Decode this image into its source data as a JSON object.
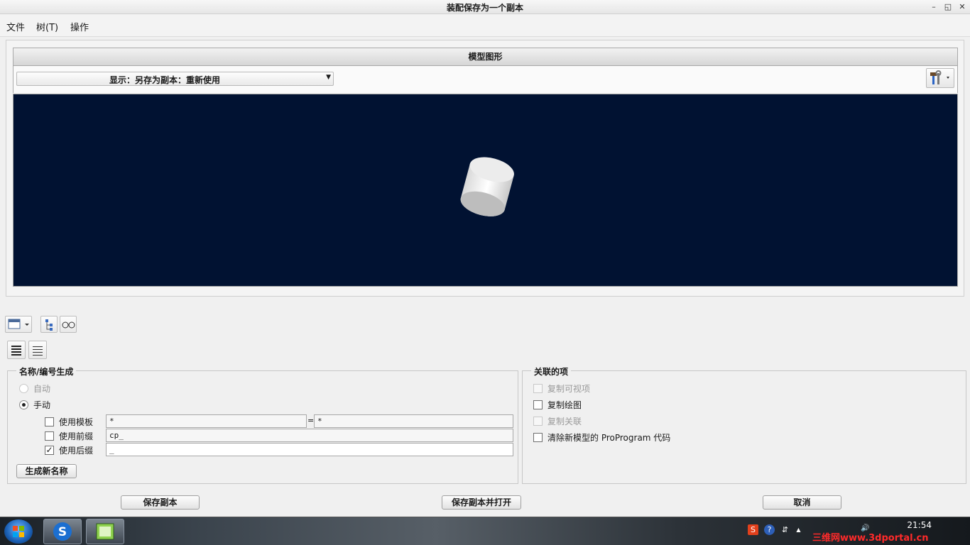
{
  "window": {
    "title": "装配保存为一个副本",
    "controls": {
      "minimize": "–",
      "restore": "◱",
      "close": "✕"
    }
  },
  "menubar": {
    "items": [
      "文件",
      "树(T)",
      "操作"
    ]
  },
  "model": {
    "header": "模型图形",
    "display_select": "显示：另存为副本：重新使用",
    "viewport_color": "#011232",
    "shape_icon": "cylinder-icon"
  },
  "name_gen": {
    "title": "名称/编号生成",
    "auto_label": "自动",
    "manual_label": "手动",
    "mode": "manual",
    "use_template": {
      "label": "使用模板",
      "checked": false,
      "value_left": "*",
      "equals": "=",
      "value_right": "*"
    },
    "use_prefix": {
      "label": "使用前缀",
      "checked": false,
      "value": "cp_"
    },
    "use_suffix": {
      "label": "使用后缀",
      "checked": true,
      "value": "_"
    },
    "generate_button": "生成新名称"
  },
  "related": {
    "title": "关联的项",
    "items": [
      {
        "label": "复制可视项",
        "checked": false,
        "enabled": false
      },
      {
        "label": "复制绘图",
        "checked": false,
        "enabled": true
      },
      {
        "label": "复制关联",
        "checked": false,
        "enabled": false
      },
      {
        "label": "清除新模型的 ProProgram 代码",
        "checked": false,
        "enabled": true
      }
    ]
  },
  "buttons": {
    "save_copy": "保存副本",
    "save_and_open": "保存副本并打开",
    "cancel": "取消"
  },
  "taskbar": {
    "clock": "21:54",
    "watermark": "三维网www.3dportal.cn",
    "tray": [
      "S",
      "?",
      "⇵",
      "▲",
      "🔊"
    ]
  }
}
